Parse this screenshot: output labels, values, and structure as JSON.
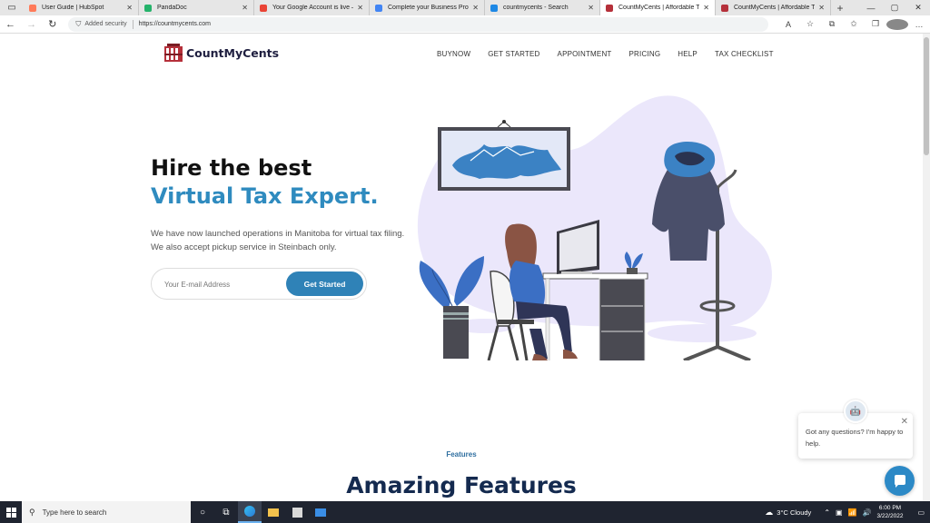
{
  "browser": {
    "tabs": [
      {
        "title": "User Guide | HubSpot",
        "color": "#ff7a59",
        "active": false
      },
      {
        "title": "PandaDoc",
        "color": "#25b36b",
        "active": false
      },
      {
        "title": "Your Google Account is live – m",
        "color": "#ea4335",
        "active": false
      },
      {
        "title": "Complete your Business Profile",
        "color": "#4285f4",
        "active": false
      },
      {
        "title": "countmycents - Search",
        "color": "#1e88e5",
        "active": false
      },
      {
        "title": "CountMyCents | Affordable Tax",
        "color": "#b5303a",
        "active": true
      },
      {
        "title": "CountMyCents | Affordable Tax",
        "color": "#b5303a",
        "active": false
      }
    ],
    "address": {
      "security_label": "Added security",
      "url": "https://countmycents.com"
    }
  },
  "site": {
    "logo_text": "CountMyCents",
    "nav": [
      "BUYNOW",
      "GET STARTED",
      "APPOINTMENT",
      "PRICING",
      "HELP",
      "TAX CHECKLIST"
    ],
    "hero": {
      "title_line1": "Hire the best",
      "title_line2": "Virtual Tax Expert.",
      "desc_line1": "We have now launched operations in Manitoba for virtual tax filing.",
      "desc_line2": "We also accept pickup service in Steinbach only.",
      "email_placeholder": "Your E-mail Address",
      "cta_label": "Get Started"
    },
    "features": {
      "label": "Features",
      "title": "Amazing Features"
    },
    "chat": {
      "message": "Got any questions? I'm happy to help."
    },
    "colors": {
      "accent": "#2f8bbf",
      "button": "#2f82b7",
      "heading_dark": "#142a4f"
    }
  },
  "taskbar": {
    "search_placeholder": "Type here to search",
    "weather": "3°C  Cloudy",
    "time": "6:00 PM",
    "date": "3/22/2022"
  }
}
